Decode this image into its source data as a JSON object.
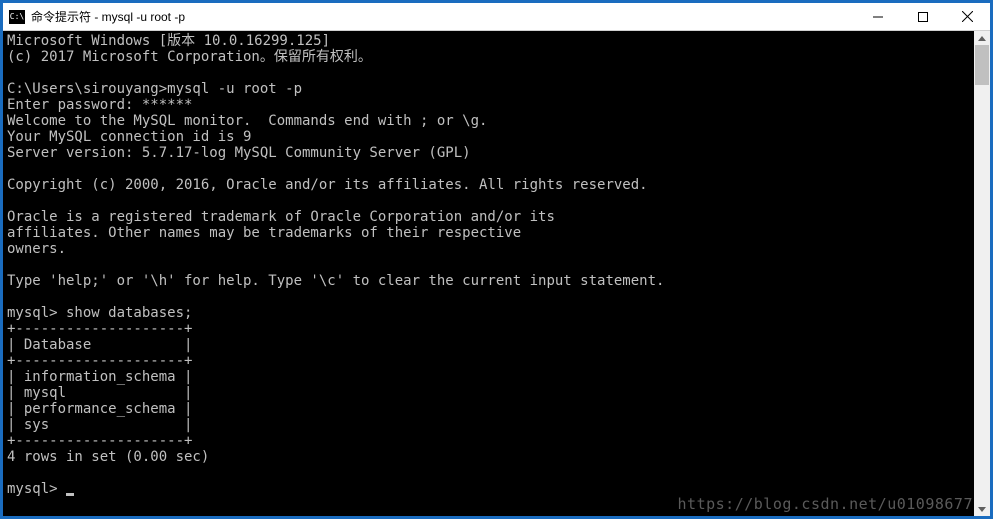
{
  "titlebar": {
    "icon_label": "C:\\",
    "title": "命令提示符 - mysql  -u root -p"
  },
  "terminal": {
    "lines": [
      "Microsoft Windows [版本 10.0.16299.125]",
      "(c) 2017 Microsoft Corporation。保留所有权利。",
      "",
      "C:\\Users\\sirouyang>mysql -u root -p",
      "Enter password: ******",
      "Welcome to the MySQL monitor.  Commands end with ; or \\g.",
      "Your MySQL connection id is 9",
      "Server version: 5.7.17-log MySQL Community Server (GPL)",
      "",
      "Copyright (c) 2000, 2016, Oracle and/or its affiliates. All rights reserved.",
      "",
      "Oracle is a registered trademark of Oracle Corporation and/or its",
      "affiliates. Other names may be trademarks of their respective",
      "owners.",
      "",
      "Type 'help;' or '\\h' for help. Type '\\c' to clear the current input statement.",
      "",
      "mysql> show databases;",
      "+--------------------+",
      "| Database           |",
      "+--------------------+",
      "| information_schema |",
      "| mysql              |",
      "| performance_schema |",
      "| sys                |",
      "+--------------------+",
      "4 rows in set (0.00 sec)",
      "",
      "mysql> "
    ]
  },
  "watermark": "https://blog.csdn.net/u01098677"
}
